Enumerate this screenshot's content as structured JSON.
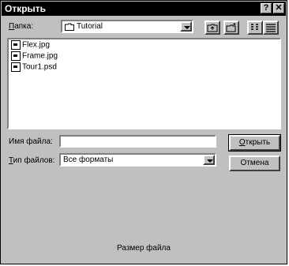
{
  "window": {
    "title": "Открыть"
  },
  "titlebar": {
    "help_glyph": "?",
    "close_glyph": "✕"
  },
  "lookin": {
    "label_prefix": "П",
    "label_rest": "апка:",
    "value": "Tutorial"
  },
  "files": [
    {
      "name": "Flex.jpg"
    },
    {
      "name": "Frame.jpg"
    },
    {
      "name": "Tour1.psd"
    }
  ],
  "filename": {
    "label": "Имя файла:",
    "value": ""
  },
  "filetype": {
    "label_prefix": "Т",
    "label_rest": "ип файлов:",
    "value": "Все форматы"
  },
  "buttons": {
    "open_prefix": "О",
    "open_rest": "ткрыть",
    "cancel": "Отмена"
  },
  "status": {
    "text": "Размер файла"
  },
  "icons": [
    "folder-icon",
    "up-folder-icon",
    "new-folder-icon",
    "list-view-icon",
    "details-view-icon",
    "file-icon"
  ]
}
